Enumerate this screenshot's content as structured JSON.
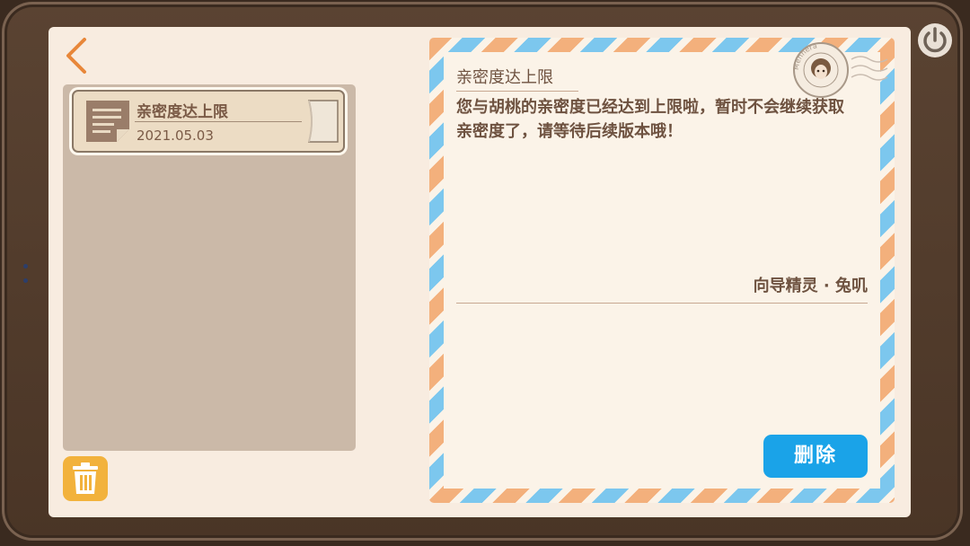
{
  "mail_list": [
    {
      "title": "亲密度达上限",
      "date": "2021.05.03",
      "icon": "letter-icon"
    }
  ],
  "letter": {
    "title": "亲密度达上限",
    "body": "您与胡桃的亲密度已经达到上限啦，暂时不会继续获取亲密度了，请等待后续版本哦！",
    "signature": "向导精灵 · 兔叽",
    "stamp_text": "Menhera",
    "delete_label": "删除"
  },
  "icons": {
    "back": "chevron-left-icon",
    "power": "power-icon",
    "trash": "trash-icon"
  },
  "colors": {
    "accent_orange": "#e8873a",
    "delete_blue": "#1aa3e8",
    "trash_yellow": "#f2b23c",
    "stripe_orange": "#f3b07c",
    "stripe_blue": "#7cc7ee"
  }
}
